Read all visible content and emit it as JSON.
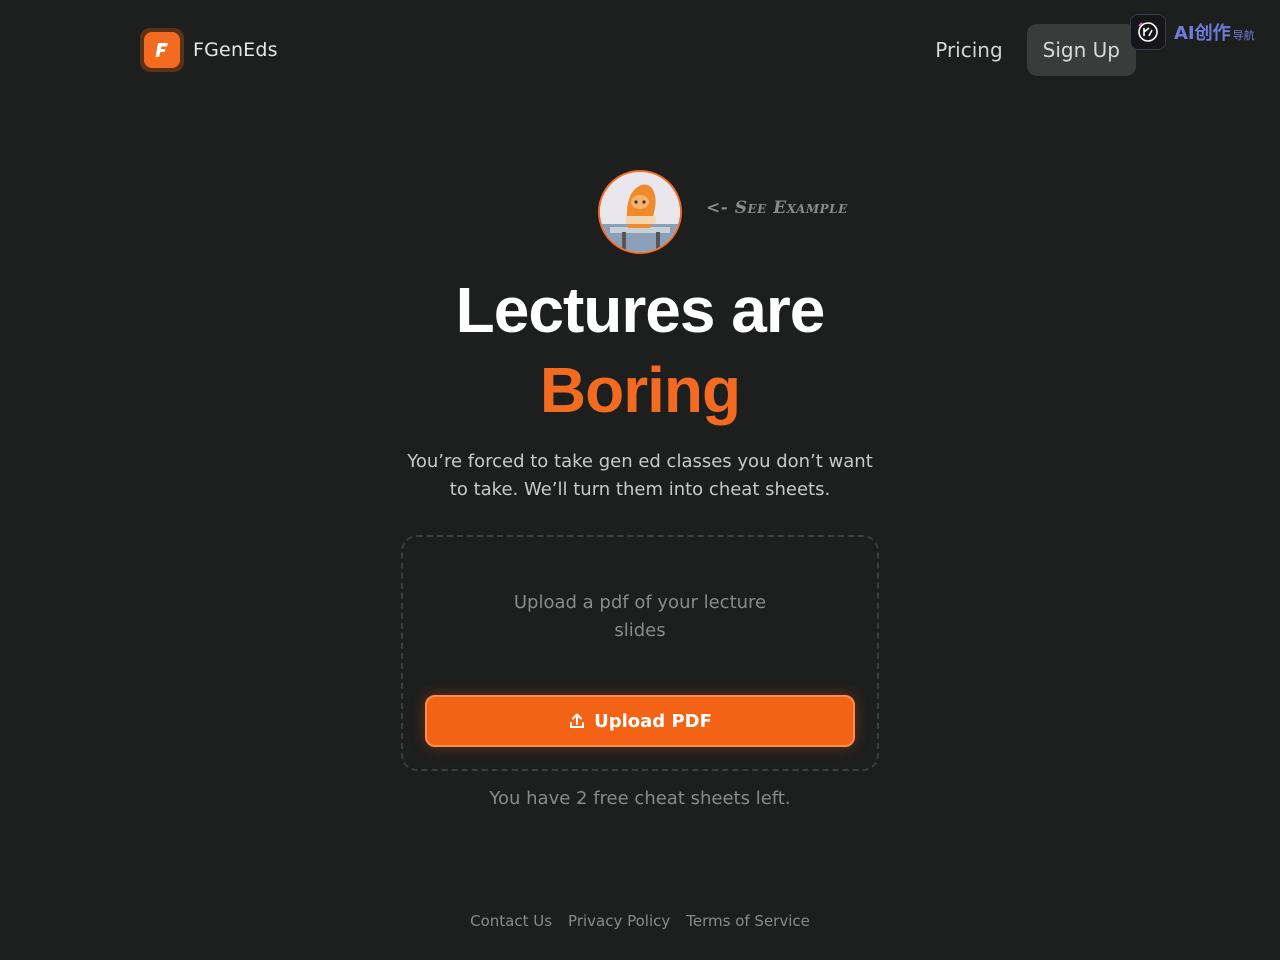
{
  "header": {
    "brand_name": "FGenEds",
    "logo_letter": "F",
    "nav": {
      "pricing_label": "Pricing",
      "signup_label": "Sign Up"
    },
    "ai_badge": {
      "main_text": "AI创作",
      "sub_text": "导航"
    }
  },
  "hero": {
    "see_example_label": "<- See Example",
    "headline_line1": "Lectures are",
    "headline_line2": "Boring",
    "subtitle": "You’re forced to take gen ed classes you don’t want to take. We’ll turn them into cheat sheets."
  },
  "upload": {
    "hint_line1": "Upload a pdf of your lecture",
    "hint_line2": "slides",
    "button_label": "Upload PDF",
    "button_icon": "upload-icon",
    "free_left_text": "You have 2 free cheat sheets left."
  },
  "footer": {
    "links": [
      "Contact Us",
      "Privacy Policy",
      "Terms of Service"
    ]
  },
  "colors": {
    "background": "#1d1e1e",
    "accent": "#f26b21",
    "button": "#f26316"
  }
}
